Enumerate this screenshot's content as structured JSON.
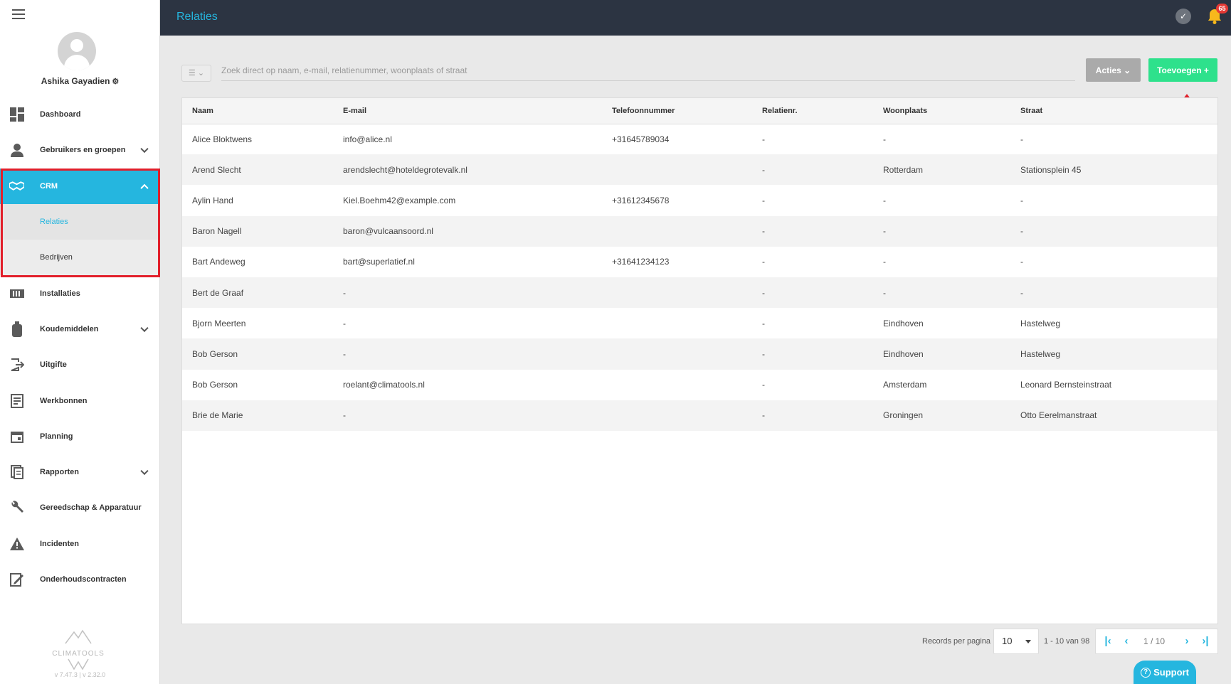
{
  "sidebar": {
    "user_name": "Ashika Gayadien",
    "items": [
      {
        "label": "Dashboard",
        "icon": "dashboard-icon"
      },
      {
        "label": "Gebruikers en groepen",
        "icon": "user-icon"
      },
      {
        "label": "CRM",
        "icon": "handshake-icon"
      },
      {
        "label": "Relaties"
      },
      {
        "label": "Bedrijven"
      },
      {
        "label": "Installaties",
        "icon": "installation-icon"
      },
      {
        "label": "Koudemiddelen",
        "icon": "cylinder-icon"
      },
      {
        "label": "Uitgifte",
        "icon": "export-icon"
      },
      {
        "label": "Werkbonnen",
        "icon": "workorder-icon"
      },
      {
        "label": "Planning",
        "icon": "calendar-icon"
      },
      {
        "label": "Rapporten",
        "icon": "report-icon"
      },
      {
        "label": "Gereedschap & Apparatuur",
        "icon": "wrench-icon"
      },
      {
        "label": "Incidenten",
        "icon": "warning-icon"
      },
      {
        "label": "Onderhoudscontracten",
        "icon": "contract-icon"
      }
    ],
    "logo_text": "CLIMATOOLS",
    "version": "v 7.47.3   | v 2.32.0"
  },
  "header": {
    "title": "Relaties",
    "notification_count": "65"
  },
  "toolbar": {
    "search_placeholder": "Zoek direct op naam, e-mail, relatienummer, woonplaats of straat",
    "acties_label": "Acties",
    "toevoegen_label": "Toevoegen +"
  },
  "table": {
    "columns": [
      "Naam",
      "E-mail",
      "Telefoonnummer",
      "Relatienr.",
      "Woonplaats",
      "Straat"
    ],
    "rows": [
      [
        "Alice Bloktwens",
        "info@alice.nl",
        "+31645789034",
        "-",
        "-",
        "-"
      ],
      [
        "Arend Slecht",
        "arendslecht@hoteldegrotevalk.nl",
        "",
        "-",
        "Rotterdam",
        "Stationsplein 45"
      ],
      [
        "Aylin Hand",
        "Kiel.Boehm42@example.com",
        "+31612345678",
        "-",
        "-",
        "-"
      ],
      [
        "Baron Nagell",
        "baron@vulcaansoord.nl",
        "",
        "-",
        "-",
        "-"
      ],
      [
        "Bart Andeweg",
        "bart@superlatief.nl",
        "+31641234123",
        "-",
        "-",
        "-"
      ],
      [
        "Bert de Graaf",
        "-",
        "",
        "-",
        "-",
        "-"
      ],
      [
        "Bjorn Meerten",
        "-",
        "",
        "-",
        "Eindhoven",
        "Hastelweg"
      ],
      [
        "Bob Gerson",
        "-",
        "",
        "-",
        "Eindhoven",
        "Hastelweg"
      ],
      [
        "Bob Gerson",
        "roelant@climatools.nl",
        "",
        "-",
        "Amsterdam",
        "Leonard Bernsteinstraat"
      ],
      [
        "Brie de Marie",
        "-",
        "",
        "-",
        "Groningen",
        "Otto Eerelmanstraat"
      ]
    ]
  },
  "pagination": {
    "records_label": "Records per pagina",
    "per_page": "10",
    "range": "1 - 10 van 98",
    "page": "1 / 10"
  },
  "support_label": "Support",
  "colors": {
    "accent": "#25b6df",
    "topbar": "#2c3442",
    "add_button": "#2ee18c",
    "highlight": "#e21f2a"
  }
}
